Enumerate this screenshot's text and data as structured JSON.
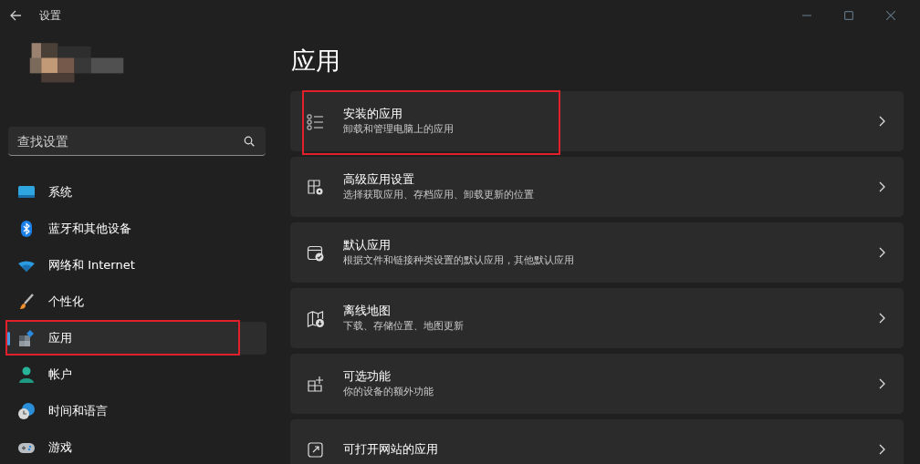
{
  "window": {
    "title": "设置"
  },
  "search": {
    "placeholder": "查找设置"
  },
  "nav": [
    {
      "label": "系统",
      "selected": false,
      "annotated": false
    },
    {
      "label": "蓝牙和其他设备",
      "selected": false,
      "annotated": false
    },
    {
      "label": "网络和 Internet",
      "selected": false,
      "annotated": false
    },
    {
      "label": "个性化",
      "selected": false,
      "annotated": false
    },
    {
      "label": "应用",
      "selected": true,
      "annotated": true
    },
    {
      "label": "帐户",
      "selected": false,
      "annotated": false
    },
    {
      "label": "时间和语言",
      "selected": false,
      "annotated": false
    },
    {
      "label": "游戏",
      "selected": false,
      "annotated": false
    }
  ],
  "page": {
    "title": "应用"
  },
  "cards": [
    {
      "title": "安装的应用",
      "subtitle": "卸载和管理电脑上的应用",
      "annotated": true
    },
    {
      "title": "高级应用设置",
      "subtitle": "选择获取应用、存档应用、卸载更新的位置",
      "annotated": false
    },
    {
      "title": "默认应用",
      "subtitle": "根据文件和链接种类设置的默认应用，其他默认应用",
      "annotated": false
    },
    {
      "title": "离线地图",
      "subtitle": "下载、存储位置、地图更新",
      "annotated": false
    },
    {
      "title": "可选功能",
      "subtitle": "你的设备的额外功能",
      "annotated": false
    },
    {
      "title": "可打开网站的应用",
      "annotated": false
    }
  ]
}
